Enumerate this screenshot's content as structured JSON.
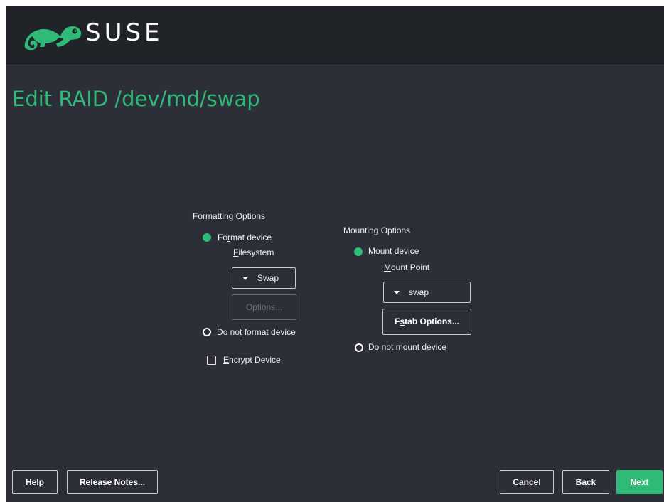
{
  "header": {
    "logo_text": "SUSE",
    "logo_icon": "chameleon-logo-icon",
    "brand_color": "#30ba78"
  },
  "page": {
    "title": "Edit RAID /dev/md/swap"
  },
  "formatting": {
    "heading": "Formatting Options",
    "format_device": {
      "before": "Fo",
      "mnemonic": "r",
      "after": "mat device",
      "selected": true
    },
    "filesystem_label": {
      "mnemonic": "F",
      "after": "ilesystem"
    },
    "filesystem_value": "Swap",
    "options_button": "Options...",
    "do_not_format": {
      "before": "Do no",
      "mnemonic": "t",
      "after": " format device",
      "selected": false
    },
    "encrypt_device": {
      "mnemonic": "E",
      "after": "ncrypt Device",
      "checked": false
    }
  },
  "mounting": {
    "heading": "Mounting Options",
    "mount_device": {
      "before": "M",
      "mnemonic": "o",
      "after": "unt device",
      "selected": true
    },
    "mount_point_label": {
      "mnemonic": "M",
      "after": "ount Point"
    },
    "mount_point_value": "swap",
    "fstab_button": {
      "before": "F",
      "mnemonic": "s",
      "after": "tab Options..."
    },
    "do_not_mount": {
      "mnemonic": "D",
      "after": "o not mount device",
      "selected": false
    }
  },
  "footer": {
    "help": {
      "mnemonic": "H",
      "after": "elp"
    },
    "release_notes": {
      "before": "Re",
      "mnemonic": "l",
      "after": "ease Notes..."
    },
    "cancel": {
      "mnemonic": "C",
      "after": "ancel"
    },
    "back": {
      "mnemonic": "B",
      "after": "ack"
    },
    "next": {
      "mnemonic": "N",
      "after": "ext"
    }
  }
}
